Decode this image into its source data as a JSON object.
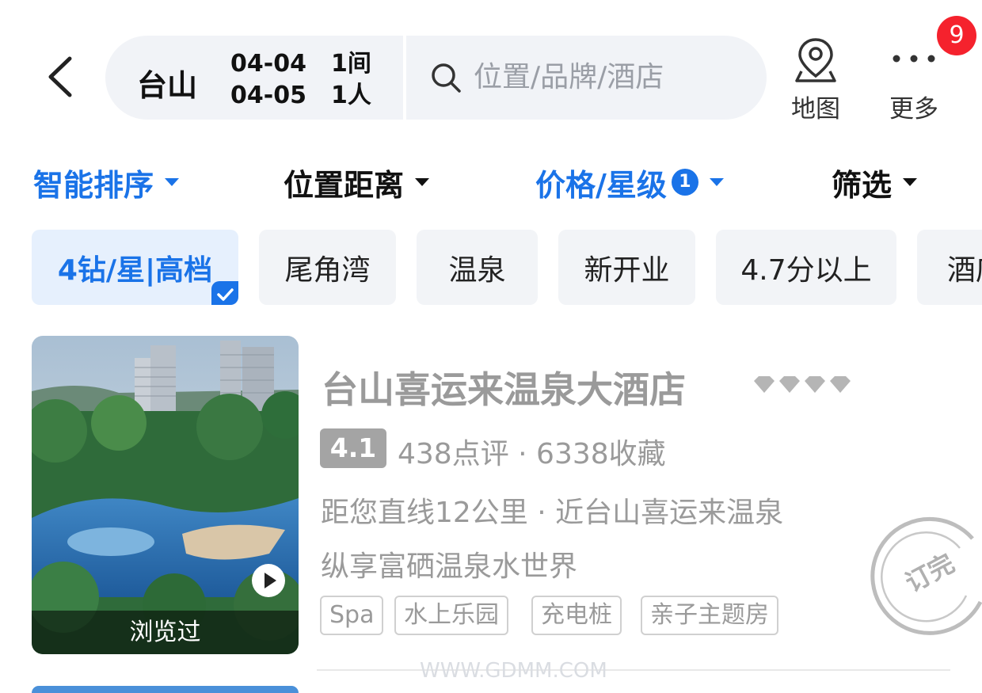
{
  "header": {
    "city": "台山",
    "checkin": "04-04",
    "checkout": "04-05",
    "rooms": "1间",
    "guests": "1人",
    "search_placeholder": "位置/品牌/酒店",
    "map_label": "地图",
    "more_label": "更多",
    "notification_count": "9"
  },
  "filter_tabs": [
    {
      "label": "智能排序",
      "active": true
    },
    {
      "label": "位置距离",
      "active": false
    },
    {
      "label": "价格/星级",
      "active": true,
      "count": "1"
    },
    {
      "label": "筛选",
      "active": false
    }
  ],
  "quick_filters": [
    {
      "label": "4钻/星|高档",
      "selected": true
    },
    {
      "label": "尾角湾",
      "selected": false
    },
    {
      "label": "温泉",
      "selected": false
    },
    {
      "label": "新开业",
      "selected": false
    },
    {
      "label": "4.7分以上",
      "selected": false
    },
    {
      "label": "酒店",
      "selected": false
    }
  ],
  "hotel": {
    "name": "台山喜运来温泉大酒店",
    "diamond_rating": 4,
    "score": "4.1",
    "reviews": "438点评 · 6338收藏",
    "distance": "距您直线12公里 · 近台山喜运来温泉",
    "slogan": "纵享富硒温泉水世界",
    "tags": [
      "Spa",
      "水上乐园",
      "充电桩",
      "亲子主题房"
    ],
    "viewed_label": "浏览过",
    "status_stamp": "订完"
  },
  "watermark": "WWW.GDMM.COM",
  "colors": {
    "accent": "#1a73e8",
    "badge": "#f5222d",
    "muted_text": "#9a9a9a",
    "pill_bg": "#f1f3f7"
  }
}
